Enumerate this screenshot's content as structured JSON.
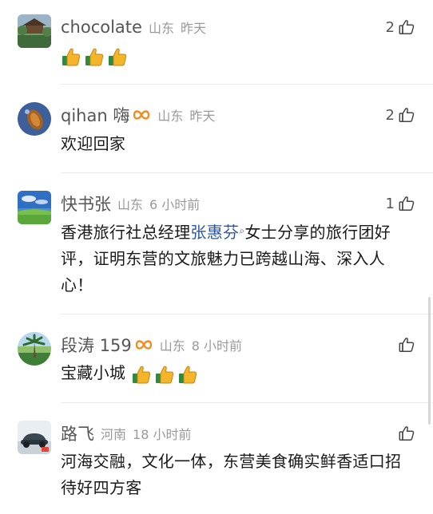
{
  "comments": [
    {
      "user": "chocolate",
      "location": "山东",
      "time": "昨天",
      "likes": "2",
      "content": "",
      "thumbs_count": 3
    },
    {
      "user": "qihan 嗨",
      "location": "山东",
      "time": "昨天",
      "likes": "2",
      "content": "欢迎回家"
    },
    {
      "user": "快书张",
      "location": "山东",
      "time": "6 小时前",
      "likes": "1",
      "content_prefix": "香港旅行社总经理",
      "mention": "张惠芬",
      "content_suffix": "女士分享的旅行团好评，证明东营的文旅魅力已跨越山海、深入人心！"
    },
    {
      "user": "段涛 159",
      "location": "山东",
      "time": "8 小时前",
      "likes": "",
      "content": "宝藏小城",
      "thumbs_count": 3
    },
    {
      "user": "路飞",
      "location": "河南",
      "time": "18 小时前",
      "likes": "",
      "content": "河海交融，文化一体，东营美食确实鲜香适口招待好四方客"
    }
  ],
  "colors": {
    "badge": "#f08c1e",
    "mention": "#2a57a5",
    "meta_gray": "#9a9a9a",
    "username": "#555555"
  },
  "icons": {
    "like": "thumbs-up-outline-icon",
    "badge": "infinity-badge-icon",
    "emoji": "thumbs-up-emoji-icon",
    "mention_search": "search-icon"
  }
}
